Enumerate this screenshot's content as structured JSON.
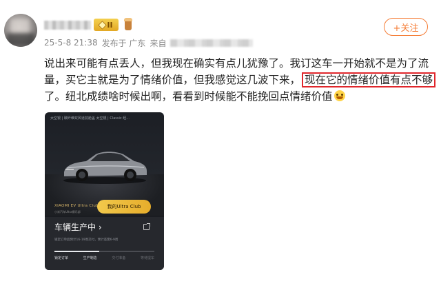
{
  "user": {
    "badge_level": "II"
  },
  "follow_label": "+关注",
  "meta": {
    "timestamp": "25-5-8 21:38",
    "posted_from": "发布于 广东",
    "source_prefix": "来自"
  },
  "post": {
    "line1": "说出来可能有点丢人，但我现在确实有点儿犹豫了。我订这车一开始就不是为了流",
    "line2_before": "量，买它主就是为了情绪价值，但我感觉这几波下来，",
    "line2_highlight": "现在它的情绪价值有点不够",
    "line3": "了。纽北成绩啥时候出啊，看看到时候能不能挽回点情绪价值"
  },
  "card": {
    "tabs": "太空银 | 碳纤维双风道前舱盖 太空银 | Classic 经...",
    "club_brand": "XIAOMI EV Ultra Club",
    "club_sub": "小米汽车Ultra俱乐部",
    "club_button": "我的Ultra Club",
    "status_title": "车辆生产中 ›",
    "status_detail": "锁定订单后预计16-19周交付，预计还需6-9周",
    "progress": 0.45,
    "steps": [
      {
        "label": "锁定订单",
        "done": true
      },
      {
        "label": "生产制造",
        "done": true
      },
      {
        "label": "交付准备",
        "done": false
      },
      {
        "label": "等待提车",
        "done": false
      }
    ]
  },
  "colors": {
    "accent_orange": "#f57c35",
    "highlight_red": "#e0262b",
    "club_gold": "#f2c94c"
  }
}
